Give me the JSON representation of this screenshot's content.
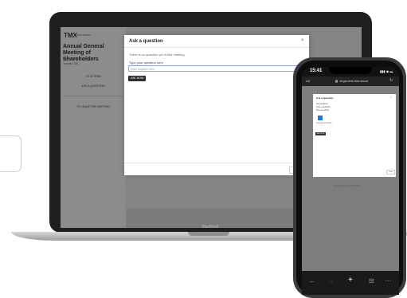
{
  "laptop": {
    "brand_label": "MacBook",
    "app": {
      "logo": "TMX",
      "logo_sub": "AGM Platform",
      "meeting_title": "Annual General Meeting of Shareholders",
      "meeting_date": "May 5, 2021, 9:30 am EDT",
      "meeting_place": "Toronto, ON",
      "sidebar_buttons": [
        "TO ATTEND",
        "ASK A QUESTION"
      ],
      "leave_label": "TO LEAVE THE MEETING"
    },
    "modal": {
      "title": "Ask a question",
      "close_glyph": "×",
      "empty_text": "There is no question yet in this meeting",
      "prompt": "Type your question here",
      "input_placeholder": "enter question here",
      "send_label": "ASK NOW",
      "close_label": "Close"
    }
  },
  "phone": {
    "time": "15:41",
    "signal": "▮▮▮ ◉ ▬",
    "aa": "AA",
    "url": "🔒 virgin-test-ikm.cloud",
    "reload": "↻",
    "modal": {
      "title": "Ask a question",
      "close_glyph": "×",
      "line1": "No questions",
      "line2": "Type a question",
      "line3": "here to submit",
      "line4": "Ask anonymously",
      "button": "ASK NOW",
      "close_label": "Close"
    },
    "bottom_link": "Powered by the AGM platform",
    "toolbar": {
      "back": "←",
      "forward": "→",
      "share": "+",
      "books": "⊟",
      "tabs": "⋯"
    }
  }
}
